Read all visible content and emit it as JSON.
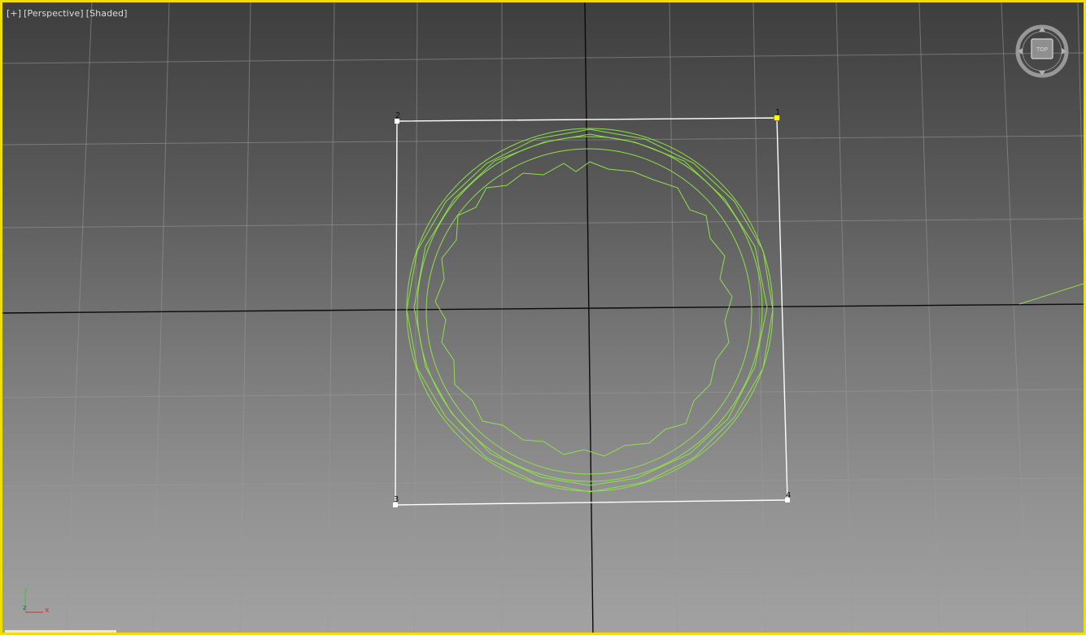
{
  "viewport": {
    "labels": {
      "menu": "[+]",
      "view": "[Perspective]",
      "shading": "[Shaded]"
    },
    "active_border_color": "#f0e000",
    "viewcube": {
      "face_label": "TOP",
      "icon": "viewcube-icon"
    },
    "spline": {
      "vertices": [
        {
          "label": "1",
          "selected": true
        },
        {
          "label": "2",
          "selected": false
        },
        {
          "label": "3",
          "selected": false
        },
        {
          "label": "4",
          "selected": false
        }
      ],
      "spline_color": "#ffffff",
      "selected_vertex_color": "#ffff00"
    },
    "object_wire_color": "#8fe04a",
    "axis_tripod": {
      "y": "y",
      "z": "z",
      "x": "x"
    }
  }
}
